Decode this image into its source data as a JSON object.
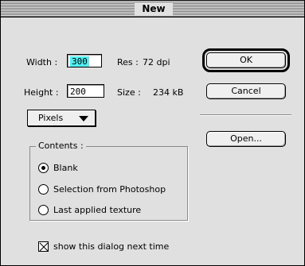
{
  "window": {
    "title": "New"
  },
  "fields": {
    "width_label": "Width :",
    "width_value": "300",
    "height_label": "Height :",
    "height_value": "200",
    "res_label": "Res :",
    "res_value": "72 dpi",
    "size_label": "Size :",
    "size_value": "234 kB"
  },
  "buttons": {
    "ok": "OK",
    "cancel": "Cancel",
    "open": "Open..."
  },
  "units_popup": {
    "selected": "Pixels"
  },
  "contents": {
    "label": "Contents :",
    "options": [
      "Blank",
      "Selection from Photoshop",
      "Last applied texture"
    ],
    "selected_index": 0
  },
  "checkbox": {
    "label": "show this dialog next time",
    "checked": true
  },
  "colors": {
    "selection_highlight": "#4ff0f5"
  }
}
